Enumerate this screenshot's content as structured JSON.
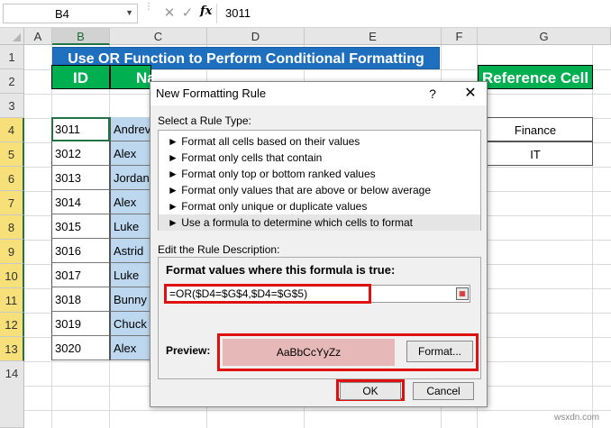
{
  "formula_bar": {
    "name_box": "B4",
    "cancel_glyph": "✕",
    "enter_glyph": "✓",
    "fx_label": "fx",
    "formula_value": "3011"
  },
  "columns": [
    "A",
    "B",
    "C",
    "D",
    "E",
    "F",
    "G"
  ],
  "rows": [
    "1",
    "2",
    "3",
    "4",
    "5",
    "6",
    "7",
    "8",
    "9",
    "10",
    "11",
    "12",
    "13",
    "14"
  ],
  "sheet": {
    "title": "Use OR Function to Perform Conditional Formatting",
    "headers": {
      "id": "ID",
      "name": "Na",
      "reference": "Reference Cell"
    },
    "ids": [
      "3011",
      "3012",
      "3013",
      "3014",
      "3015",
      "3016",
      "3017",
      "3018",
      "3019",
      "3020"
    ],
    "names": [
      "Andrev",
      "Alex",
      "Jordan",
      "Alex",
      "Luke",
      "Astrid",
      "Luke",
      "Bunny",
      "Chuck",
      "Alex"
    ],
    "reference_values": [
      "Finance",
      "IT"
    ]
  },
  "dialog": {
    "title": "New Formatting Rule",
    "help": "?",
    "close": "✕",
    "rule_type_label": "Select a Rule Type:",
    "rule_types": [
      "► Format all cells based on their values",
      "► Format only cells that contain",
      "► Format only top or bottom ranked values",
      "► Format only values that are above or below average",
      "► Format only unique or duplicate values",
      "► Use a formula to determine which cells to format"
    ],
    "selected_rule_index": 5,
    "edit_label": "Edit the Rule Description:",
    "formula_title": "Format values where this formula is true:",
    "formula": "=OR($D4=$G$4,$D4=$G$5)",
    "preview_label": "Preview:",
    "preview_text": "AaBbCcYyZz",
    "format_button": "Format...",
    "ok_button": "OK",
    "cancel_button": "Cancel",
    "colors": {
      "highlight": "#e01010",
      "preview_fill": "#e6b8b7",
      "header_green": "#00b050",
      "title_blue": "#1f6fbf"
    }
  },
  "watermark": "wsxdn.com"
}
